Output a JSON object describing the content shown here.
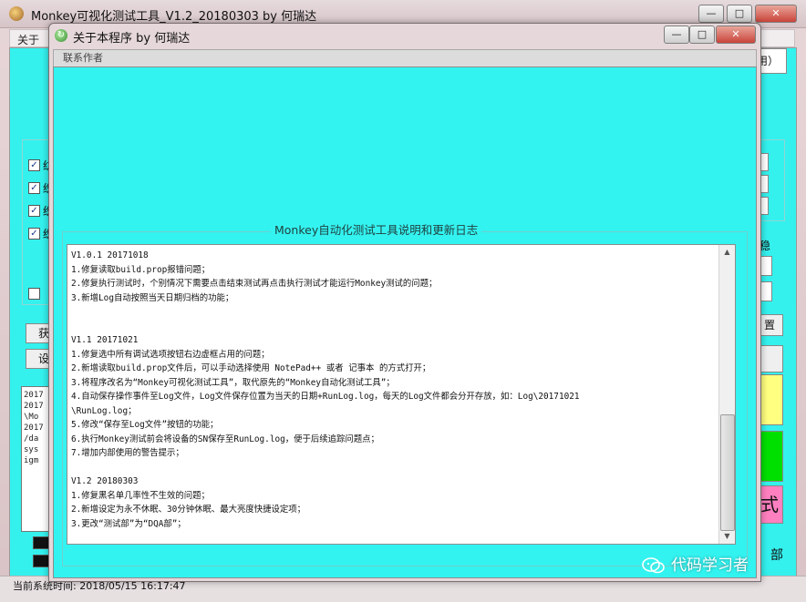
{
  "main_window": {
    "title": "Monkey可视化测试工具_V1.2_20180303 by 何瑞达",
    "menu_about": "关于",
    "left_fragments": {
      "checkbox_labels": [
        "纺",
        "织",
        "织",
        "织"
      ],
      "button_labels": [
        "获",
        "设"
      ]
    },
    "left_log_lines": [
      "2017",
      "",
      "2017",
      "\\Mo",
      "",
      "",
      "2017",
      "/da",
      "sys",
      "igm"
    ],
    "right_fragments": {
      "header_tail": "用）",
      "setting_tail": "置",
      "mode_button": "式",
      "side_label": "部",
      "right_small": "稳"
    }
  },
  "status_bar": {
    "label": "当前系统时间:",
    "time": "2018/05/15 16:17:47"
  },
  "dialog": {
    "title": "关于本程序 by 何瑞达",
    "tab_contact": "联系作者",
    "changelog_legend": "Monkey自动化测试工具说明和更新日志",
    "changelog_lines": [
      "V1.0.1 20171018",
      "1.修复读取build.prop报错问题；",
      "2.修复执行测试时，个别情况下需要点击结束测试再点击执行测试才能运行Monkey测试的问题；",
      "3.新增Log自动按照当天日期归档的功能；",
      "",
      "",
      "V1.1 20171021",
      "1.修复选中所有调试选项按钮右边虚框占用的问题；",
      "2.新增读取build.prop文件后，可以手动选择使用 NotePad++ 或者 记事本 的方式打开；",
      "3.将程序改名为“Monkey可视化测试工具”，取代原先的“Monkey自动化测试工具”；",
      "4.自动保存操作事件至Log文件，Log文件保存位置为当天的日期+RunLog.log，每天的Log文件都会分开存放，如：Log\\20171021",
      "\\RunLog.log；",
      "5.修改“保存至Log文件”按钮的功能；",
      "6.执行Monkey测试前会将设备的SN保存至RunLog.log，便于后续追踪问题点；",
      "7.增加内部使用的警告提示；",
      "",
      "V1.2 20180303",
      "1.修复黑名单几率性不生效的问题；",
      "2.新增设定为永不休眠、30分钟休眠、最大亮度快捷设定项；",
      "3.更改“测试部”为“DQA部”；"
    ]
  },
  "watermark": {
    "text": "代码学习者"
  },
  "colors": {
    "client_cyan": "#34f1ee",
    "yellow_button": "#ffff80",
    "green_button": "#00e000",
    "pink_button": "#ff80c0"
  },
  "icons": {
    "main_app": "monkey-app-icon",
    "dialog": "dialog-refresh-icon",
    "watermark": "wechat-logo-icon"
  }
}
